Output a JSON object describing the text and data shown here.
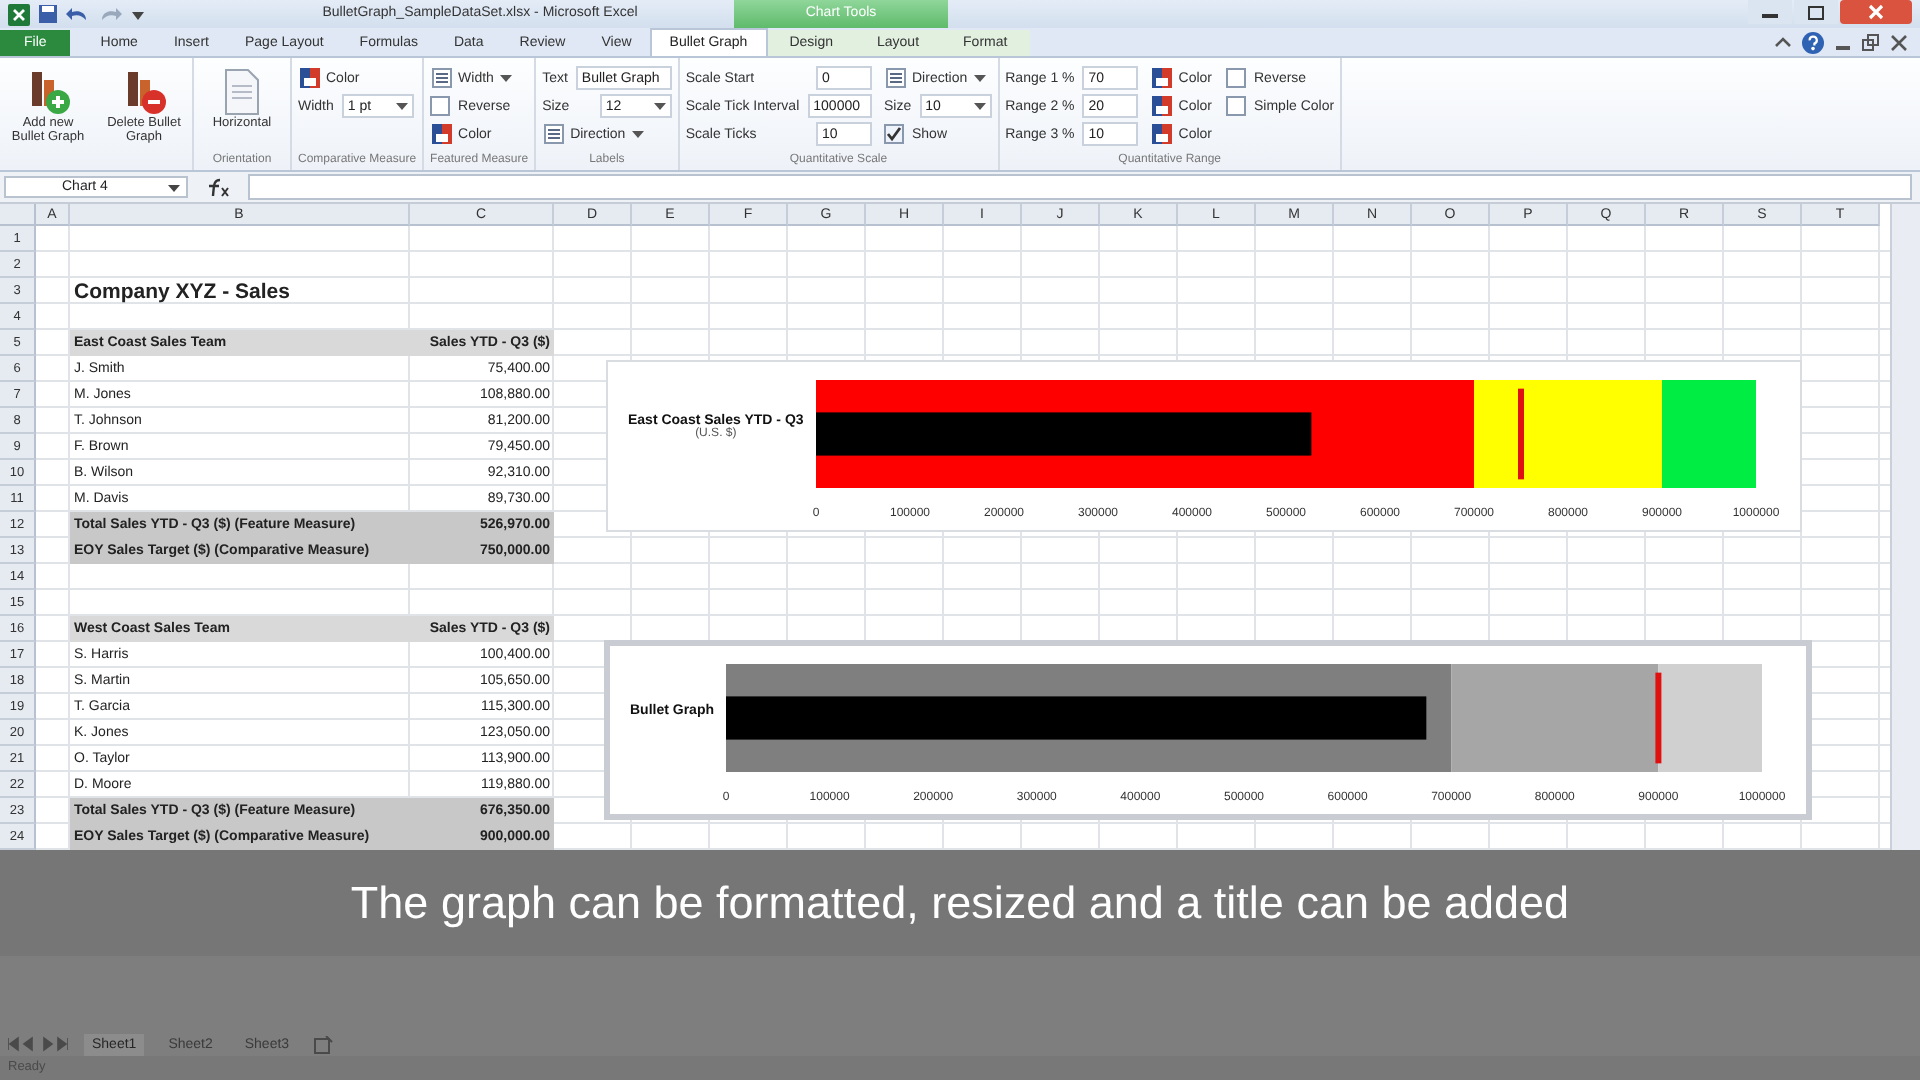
{
  "window": {
    "title": "BulletGraph_SampleDataSet.xlsx - Microsoft Excel",
    "context_group": "Chart Tools"
  },
  "ribbon_tabs": [
    {
      "label": "File",
      "kind": "file",
      "selected": false
    },
    {
      "label": "Home",
      "kind": "plain",
      "selected": false
    },
    {
      "label": "Insert",
      "kind": "plain",
      "selected": false
    },
    {
      "label": "Page Layout",
      "kind": "plain",
      "selected": false
    },
    {
      "label": "Formulas",
      "kind": "plain",
      "selected": false
    },
    {
      "label": "Data",
      "kind": "plain",
      "selected": false
    },
    {
      "label": "Review",
      "kind": "plain",
      "selected": false
    },
    {
      "label": "View",
      "kind": "plain",
      "selected": false
    },
    {
      "label": "Bullet Graph",
      "kind": "plain",
      "selected": true
    },
    {
      "label": "Design",
      "kind": "context",
      "selected": false
    },
    {
      "label": "Layout",
      "kind": "context",
      "selected": false
    },
    {
      "label": "Format",
      "kind": "context",
      "selected": false
    }
  ],
  "ribbon_groups": [
    {
      "columns": [
        [
          {
            "kind": "add",
            "label": "Add new Bullet Graph"
          }
        ],
        [
          {
            "kind": "delete",
            "label": "Delete Bullet Graph"
          }
        ]
      ]
    },
    {
      "label": "Orientation",
      "columns": [
        [
          {
            "kind": "orient",
            "label": "Horizontal"
          }
        ]
      ]
    },
    {
      "label": "Comparative Measure",
      "columns": [
        [
          {
            "kind": "color",
            "label": "Color"
          },
          {
            "kind": "dropdown",
            "label": "Width",
            "value": "1 pt"
          }
        ]
      ]
    },
    {
      "label": "Featured Measure",
      "columns": [
        [
          {
            "kind": "menu",
            "label": "Width"
          },
          {
            "kind": "check",
            "label": "Reverse",
            "checked": false
          },
          {
            "kind": "color",
            "label": "Color"
          }
        ]
      ]
    },
    {
      "label": "Labels",
      "columns": [
        [
          {
            "kind": "field",
            "label": "Text",
            "value": "Bullet Graph"
          },
          {
            "kind": "dropdown",
            "label": "Size",
            "value": "12"
          },
          {
            "kind": "menu",
            "label": "Direction"
          }
        ]
      ]
    },
    {
      "label": "Quantitative Scale",
      "columns": [
        [
          {
            "kind": "field",
            "label": "Scale Start",
            "value": "0"
          },
          {
            "kind": "field",
            "label": "Scale Tick Interval",
            "value": "100000"
          },
          {
            "kind": "field",
            "label": "Scale Ticks",
            "value": "10"
          }
        ],
        [
          {
            "kind": "menu",
            "label": "Direction"
          },
          {
            "kind": "dropdown",
            "label": "Size",
            "value": "10"
          },
          {
            "kind": "check",
            "label": "Show",
            "checked": true
          }
        ]
      ]
    },
    {
      "label": "Quantitative Range",
      "columns": [
        [
          {
            "kind": "field",
            "label": "Range 1 %",
            "value": "70"
          },
          {
            "kind": "field",
            "label": "Range 2 %",
            "value": "20"
          },
          {
            "kind": "field",
            "label": "Range 3 %",
            "value": "10"
          }
        ],
        [
          {
            "kind": "color",
            "label": "Color"
          },
          {
            "kind": "color",
            "label": "Color"
          },
          {
            "kind": "color",
            "label": "Color"
          }
        ],
        [
          {
            "kind": "check",
            "label": "Reverse",
            "checked": false
          },
          {
            "kind": "check",
            "label": "Simple Color",
            "checked": false
          }
        ]
      ]
    }
  ],
  "formula_bar": {
    "name_box": "Chart 4"
  },
  "sheet": {
    "columns": [
      "A",
      "B",
      "C",
      "D",
      "E",
      "F",
      "G",
      "H",
      "I",
      "J",
      "K",
      "L",
      "M",
      "N",
      "O",
      "P",
      "Q",
      "R",
      "S",
      "T"
    ],
    "rows": [
      {
        "number": "1",
        "kind": "blank"
      },
      {
        "number": "2",
        "kind": "blank"
      },
      {
        "number": "3",
        "kind": "title",
        "label": "Company XYZ - Sales"
      },
      {
        "number": "4",
        "kind": "blank"
      },
      {
        "number": "5",
        "kind": "header",
        "label": "East Coast Sales Team",
        "value": "Sales YTD - Q3 ($)"
      },
      {
        "number": "6",
        "kind": "data",
        "label": "J. Smith",
        "value": "75,400.00"
      },
      {
        "number": "7",
        "kind": "data",
        "label": "M. Jones",
        "value": "108,880.00"
      },
      {
        "number": "8",
        "kind": "data",
        "label": "T. Johnson",
        "value": "81,200.00"
      },
      {
        "number": "9",
        "kind": "data",
        "label": "F. Brown",
        "value": "79,450.00"
      },
      {
        "number": "10",
        "kind": "data",
        "label": "B. Wilson",
        "value": "92,310.00"
      },
      {
        "number": "11",
        "kind": "data",
        "label": "M. Davis",
        "value": "89,730.00"
      },
      {
        "number": "12",
        "kind": "total",
        "label": "Total Sales YTD - Q3 ($) (Feature Measure)",
        "value": "526,970.00"
      },
      {
        "number": "13",
        "kind": "total",
        "label": "EOY Sales Target ($) (Comparative Measure)",
        "value": "750,000.00"
      },
      {
        "number": "14",
        "kind": "blank"
      },
      {
        "number": "15",
        "kind": "blank"
      },
      {
        "number": "16",
        "kind": "header",
        "label": "West Coast Sales Team",
        "value": "Sales YTD - Q3 ($)"
      },
      {
        "number": "17",
        "kind": "data",
        "label": "S. Harris",
        "value": "100,400.00"
      },
      {
        "number": "18",
        "kind": "data",
        "label": "S. Martin",
        "value": "105,650.00"
      },
      {
        "number": "19",
        "kind": "data",
        "label": "T. Garcia",
        "value": "115,300.00"
      },
      {
        "number": "20",
        "kind": "data",
        "label": "K. Jones",
        "value": "123,050.00"
      },
      {
        "number": "21",
        "kind": "data",
        "label": "O. Taylor",
        "value": "113,900.00"
      },
      {
        "number": "22",
        "kind": "data",
        "label": "D. Moore",
        "value": "119,880.00"
      },
      {
        "number": "23",
        "kind": "total",
        "label": "Total Sales YTD - Q3 ($) (Feature Measure)",
        "value": "676,350.00"
      },
      {
        "number": "24",
        "kind": "total",
        "label": "EOY Sales Target ($) (Comparative Measure)",
        "value": "900,000.00"
      }
    ]
  },
  "charts": [
    {
      "chart_data": {
        "type": "bar",
        "orientation": "horizontal",
        "title": "East Coast Sales YTD - Q3",
        "ylabel": "(U.S. $)",
        "categories": [
          null
        ],
        "xlim": [
          0,
          1000000
        ],
        "xticks": [
          0,
          100000,
          200000,
          300000,
          400000,
          500000,
          600000,
          700000,
          800000,
          900000,
          1000000
        ],
        "series": [
          {
            "color": "#000000",
            "values": [
              527000
            ]
          }
        ],
        "bands": [
          {
            "axis": "x",
            "from": 0,
            "to": 700000,
            "color": "#ff0000"
          },
          {
            "axis": "x",
            "from": 700000,
            "to": 900000,
            "color": "#ffff00"
          },
          {
            "axis": "x",
            "from": 900000,
            "to": 1000000,
            "color": "#00ee44"
          }
        ],
        "ref_lines": [
          {
            "axis": "x",
            "value": 750000,
            "color": "#e01010"
          }
        ]
      }
    },
    {
      "selected": true,
      "chart_data": {
        "type": "bar",
        "orientation": "horizontal",
        "title": "Bullet Graph",
        "categories": [
          null
        ],
        "xlim": [
          0,
          1000000
        ],
        "xticks": [
          0,
          100000,
          200000,
          300000,
          400000,
          500000,
          600000,
          700000,
          800000,
          900000,
          1000000
        ],
        "series": [
          {
            "color": "#000000",
            "values": [
              676000
            ]
          }
        ],
        "bands": [
          {
            "axis": "x",
            "from": 0,
            "to": 700000,
            "color": "#7f7f7f"
          },
          {
            "axis": "x",
            "from": 700000,
            "to": 900000,
            "color": "#a6a6a6"
          },
          {
            "axis": "x",
            "from": 900000,
            "to": 1000000,
            "color": "#d0d0d0"
          }
        ],
        "ref_lines": [
          {
            "axis": "x",
            "value": 900000,
            "color": "#e01010"
          }
        ]
      }
    }
  ],
  "caption": "The graph can be formatted, resized and a title can be added",
  "sheet_tabs": [
    {
      "label": "Sheet1",
      "selected": true
    },
    {
      "label": "Sheet2",
      "selected": false
    },
    {
      "label": "Sheet3",
      "selected": false
    }
  ],
  "status_bar": {
    "text": "Ready"
  }
}
